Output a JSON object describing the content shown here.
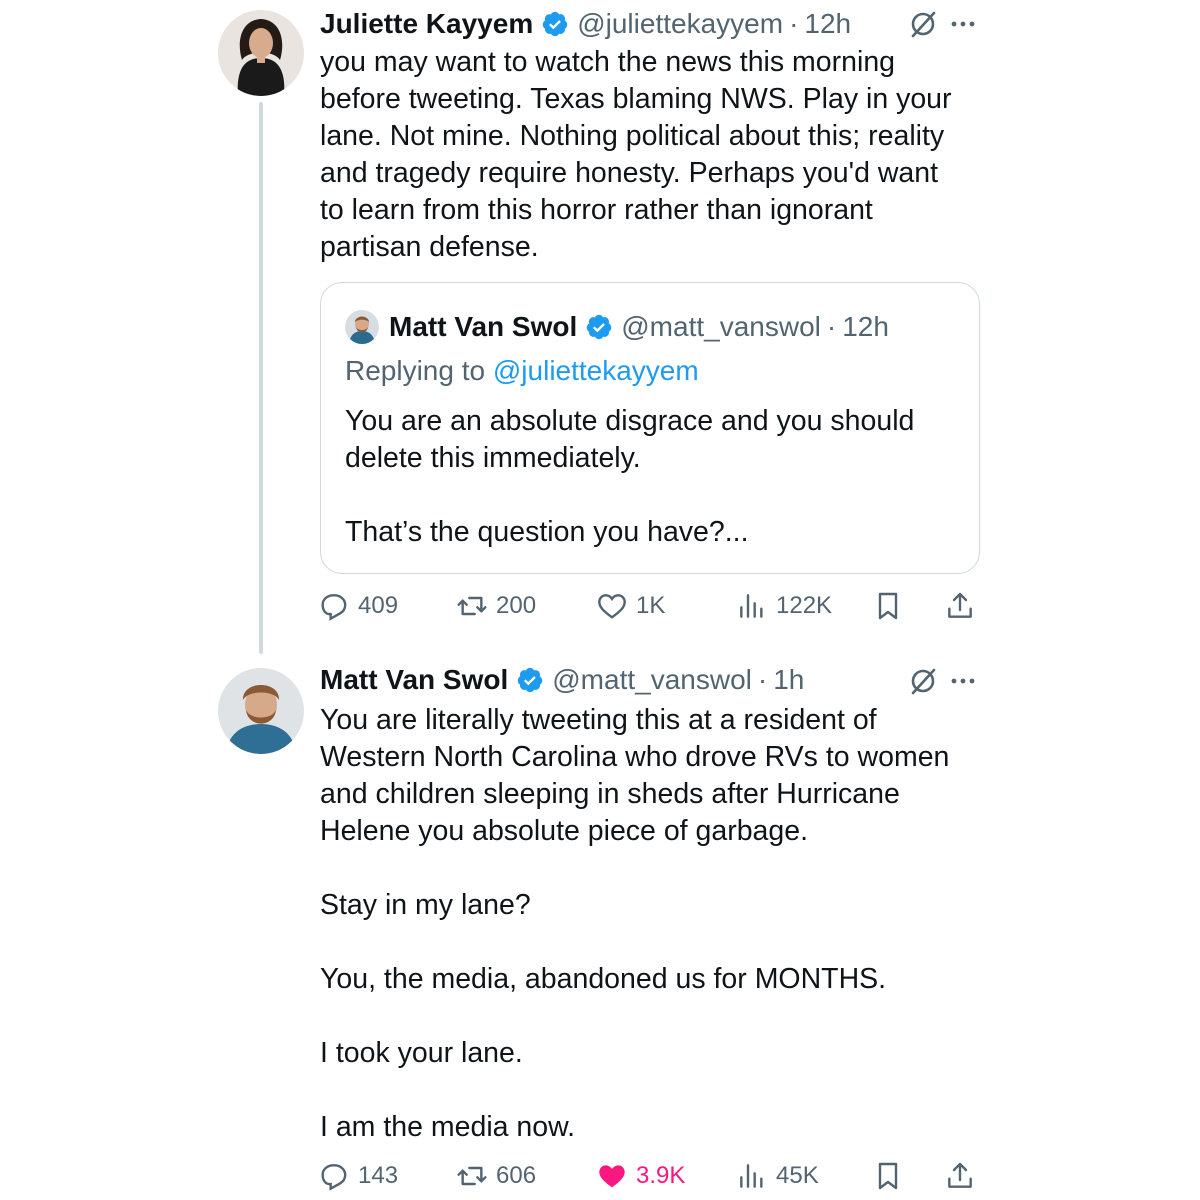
{
  "tweet1": {
    "author_name": "Juliette Kayyem",
    "handle": "@juliettekayyem",
    "separator": "·",
    "time": "12h",
    "text_lines": [
      "you may want to watch the news this morning",
      "before tweeting. Texas blaming NWS. Play in your",
      "lane. Not mine. Nothing political about this; reality",
      "and tragedy require honesty.  Perhaps you'd want",
      "to learn from this horror rather than ignorant",
      "partisan defense."
    ],
    "quote": {
      "author_name": "Matt Van Swol",
      "handle": "@matt_vanswol",
      "separator": "·",
      "time": "12h",
      "replying_prefix": "Replying to ",
      "replying_to": "@juliettekayyem",
      "line1": "You are an absolute disgrace and you should",
      "line2": "delete this immediately.",
      "line3": "That’s the question you have?..."
    },
    "stats": {
      "replies": "409",
      "reposts": "200",
      "likes": "1K",
      "views": "122K"
    }
  },
  "tweet2": {
    "author_name": "Matt Van Swol",
    "handle": "@matt_vanswol",
    "separator": "·",
    "time": "1h",
    "para1_lines": [
      "You are literally tweeting this at a resident of",
      "Western North Carolina who drove RVs to women",
      "and children sleeping in sheds after Hurricane",
      "Helene you absolute piece of garbage."
    ],
    "para2": "Stay in my lane?",
    "para3": "You, the media, abandoned us for MONTHS.",
    "para4": "I took your lane.",
    "para5": "I am the media now.",
    "stats": {
      "replies": "143",
      "reposts": "606",
      "likes": "3.9K",
      "views": "45K"
    }
  },
  "colors": {
    "verified": "#1d9bf0",
    "secondary_text": "#536471",
    "like_active": "#f91880",
    "border": "#cfd9de"
  },
  "icons": [
    "verified-badge-icon",
    "grok-icon",
    "more-icon",
    "reply-icon",
    "repost-icon",
    "like-icon",
    "views-icon",
    "bookmark-icon",
    "share-icon"
  ]
}
